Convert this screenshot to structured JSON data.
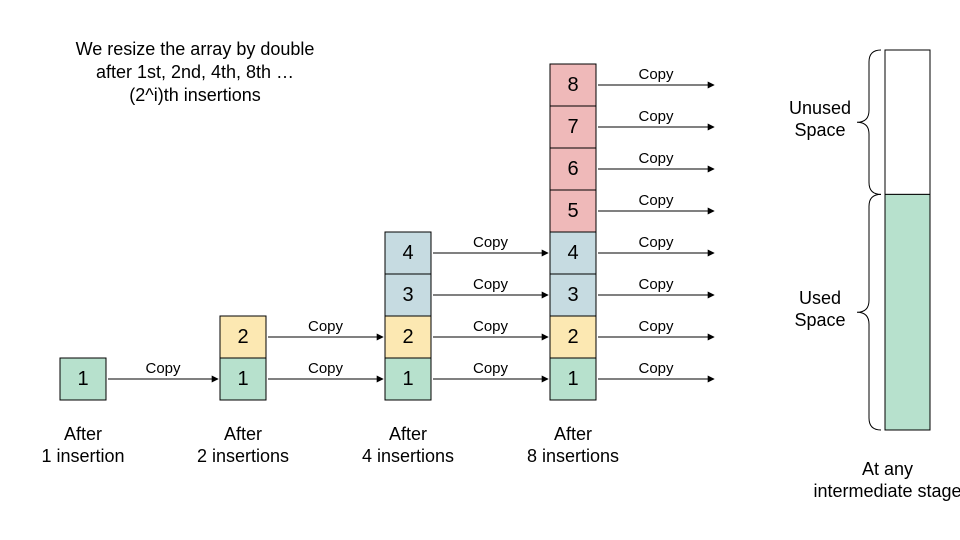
{
  "description": {
    "line1": "We resize the array by double",
    "line2": "after 1st, 2nd, 4th, 8th …",
    "line3": "(2^i)th insertions"
  },
  "copy_label": "Copy",
  "colors": {
    "green": "#b7e1cd",
    "yellow": "#fce8b2",
    "blue": "#c6dbe1",
    "pink": "#efb9b9",
    "white": "#ffffff",
    "outline": "#000000"
  },
  "stacks": [
    {
      "caption_l1": "After",
      "caption_l2": "1 insertion",
      "cells": [
        {
          "v": "1",
          "c": "green"
        }
      ]
    },
    {
      "caption_l1": "After",
      "caption_l2": "2 insertions",
      "cells": [
        {
          "v": "1",
          "c": "green"
        },
        {
          "v": "2",
          "c": "yellow"
        }
      ]
    },
    {
      "caption_l1": "After",
      "caption_l2": "4 insertions",
      "cells": [
        {
          "v": "1",
          "c": "green"
        },
        {
          "v": "2",
          "c": "yellow"
        },
        {
          "v": "3",
          "c": "blue"
        },
        {
          "v": "4",
          "c": "blue"
        }
      ]
    },
    {
      "caption_l1": "After",
      "caption_l2": "8 insertions",
      "cells": [
        {
          "v": "1",
          "c": "green"
        },
        {
          "v": "2",
          "c": "yellow"
        },
        {
          "v": "3",
          "c": "blue"
        },
        {
          "v": "4",
          "c": "blue"
        },
        {
          "v": "5",
          "c": "pink"
        },
        {
          "v": "6",
          "c": "pink"
        },
        {
          "v": "7",
          "c": "pink"
        },
        {
          "v": "8",
          "c": "pink"
        }
      ]
    }
  ],
  "right_panel": {
    "unused_label": "Unused\nSpace",
    "used_label": "Used\nSpace",
    "caption_l1": "At any",
    "caption_l2": "intermediate stage"
  }
}
